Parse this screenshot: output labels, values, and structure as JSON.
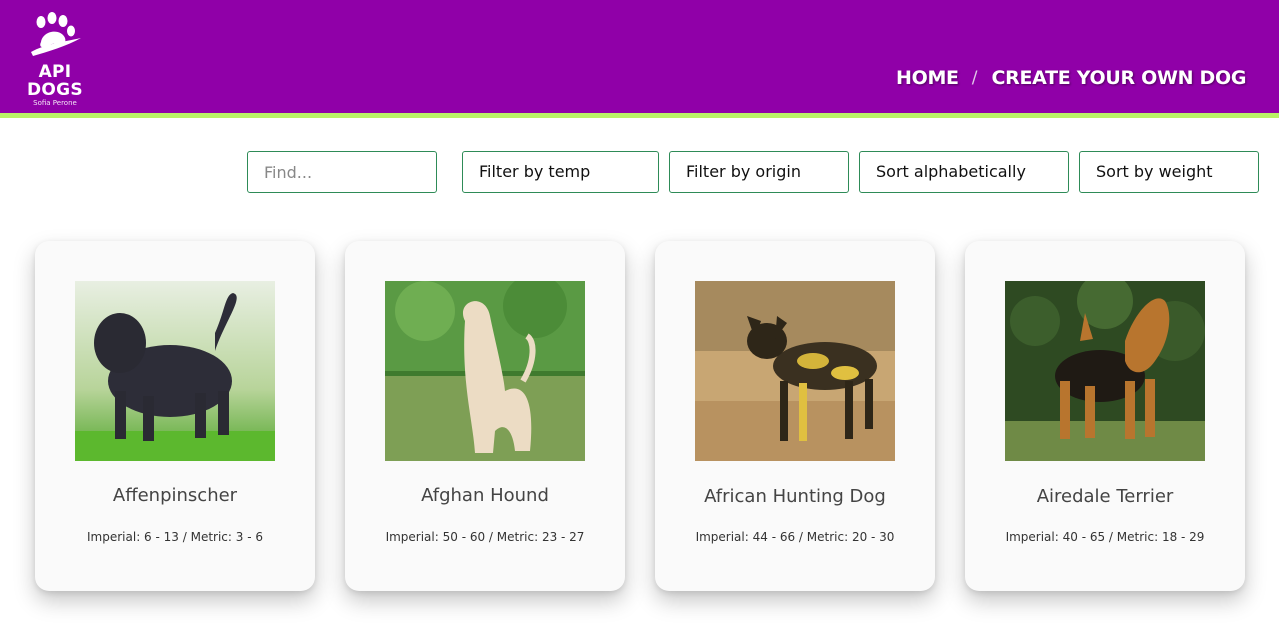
{
  "header": {
    "logo": {
      "title": "API DOGS",
      "subtitle": "Sofia Perone",
      "icon": "paw-icon"
    },
    "nav": [
      {
        "label": "HOME"
      },
      {
        "label": "CREATE YOUR OWN DOG"
      }
    ],
    "separator": "/",
    "colors": {
      "background": "#9000a8",
      "accent_line": "#b9f266"
    }
  },
  "filters": {
    "search_placeholder": "Find...",
    "search_value": "",
    "temp": "Filter by temp",
    "origin": "Filter by origin",
    "alpha": "Sort alphabetically",
    "weight": "Sort by weight"
  },
  "cards": [
    {
      "name": "Affenpinscher",
      "weight": "Imperial: 6 - 13 / Metric: 3 - 6"
    },
    {
      "name": "Afghan Hound",
      "weight": "Imperial: 50 - 60 / Metric: 23 - 27"
    },
    {
      "name": "African Hunting Dog",
      "weight": "Imperial: 44 - 66 / Metric: 20 - 30"
    },
    {
      "name": "Airedale Terrier",
      "weight": "Imperial: 40 - 65 / Metric: 18 - 29"
    }
  ]
}
